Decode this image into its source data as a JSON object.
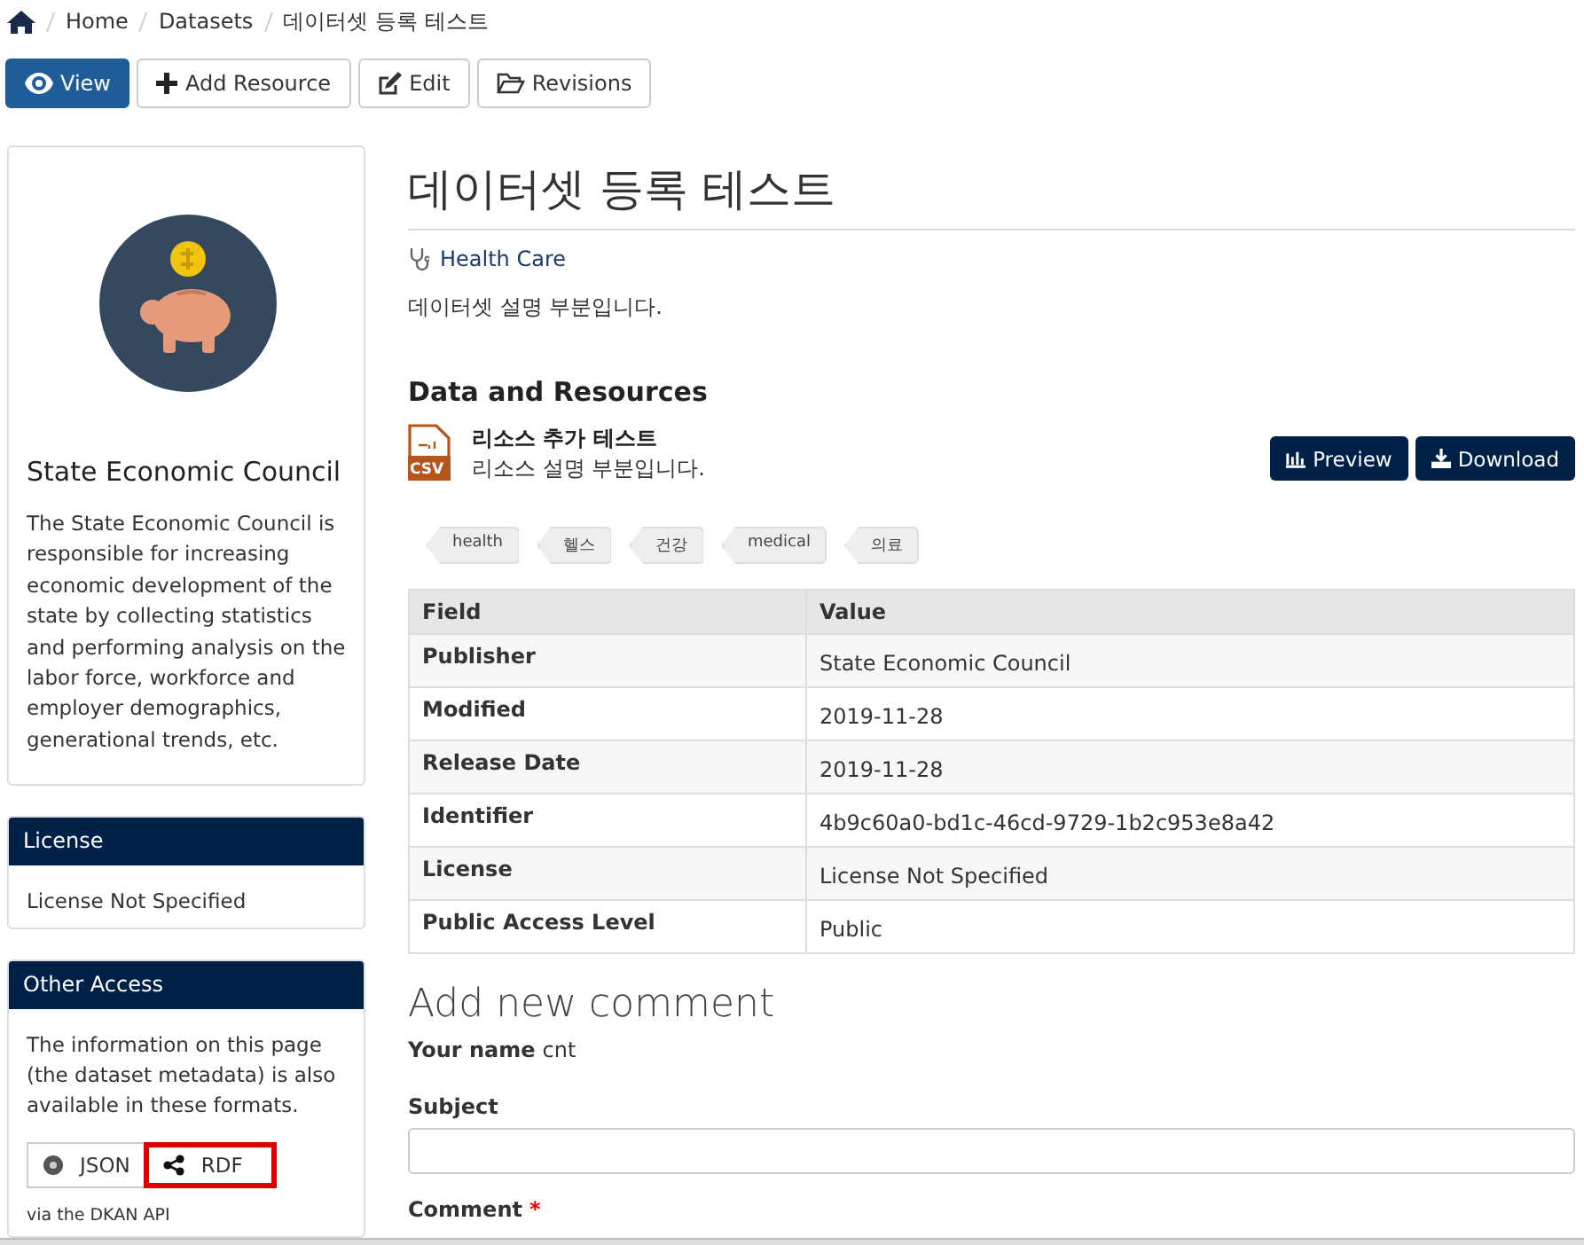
{
  "breadcrumb": [
    {
      "label": "Home"
    },
    {
      "label": "Datasets"
    },
    {
      "label": "데이터셋 등록 테스트"
    }
  ],
  "actions": [
    {
      "label": "View",
      "kind": "view",
      "selected": true
    },
    {
      "label": "Add Resource",
      "kind": "add",
      "selected": false
    },
    {
      "label": "Edit",
      "kind": "edit",
      "selected": false
    },
    {
      "label": "Revisions",
      "kind": "revisions",
      "selected": false
    }
  ],
  "publisher": {
    "name": "State Economic Council",
    "description": "The State Economic Council is responsible for increasing economic development of the state by collecting statistics and performing analysis on the labor force, workforce and employer demographics, generational trends, etc."
  },
  "license_panel": {
    "title": "License",
    "text": "License Not Specified"
  },
  "other_access": {
    "title": "Other Access",
    "text": "The information on this page (the dataset metadata) is also available in these formats.",
    "links": [
      {
        "label": "JSON",
        "kind": "json",
        "highlighted": false
      },
      {
        "label": "RDF",
        "kind": "rdf",
        "highlighted": true
      }
    ],
    "footnote": "via the DKAN API"
  },
  "dataset": {
    "title": "데이터셋 등록 테스트",
    "topic": "Health Care",
    "description": "데이터셋 설명 부분입니다."
  },
  "resources": {
    "heading": "Data and Resources",
    "items": [
      {
        "format": "CSV",
        "name": "리소스 추가 테스트",
        "description": "리소스 설명 부분입니다.",
        "buttons": [
          {
            "label": "Preview",
            "kind": "preview"
          },
          {
            "label": "Download",
            "kind": "download"
          }
        ]
      }
    ]
  },
  "tags": [
    "health",
    "헬스",
    "건강",
    "medical",
    "의료"
  ],
  "table": {
    "columns": [
      "Field",
      "Value"
    ],
    "rows": [
      [
        "Publisher",
        "State Economic Council"
      ],
      [
        "Modified",
        "2019-11-28"
      ],
      [
        "Release Date",
        "2019-11-28"
      ],
      [
        "Identifier",
        "4b9c60a0-bd1c-46cd-9729-1b2c953e8a42"
      ],
      [
        "License",
        "License Not Specified"
      ],
      [
        "Public Access Level",
        "Public"
      ]
    ]
  },
  "comment_form": {
    "title": "Add new comment",
    "name_label": "Your name",
    "name_value": "cnt",
    "subject_label": "Subject",
    "comment_label": "Comment",
    "required_mark": "*"
  }
}
